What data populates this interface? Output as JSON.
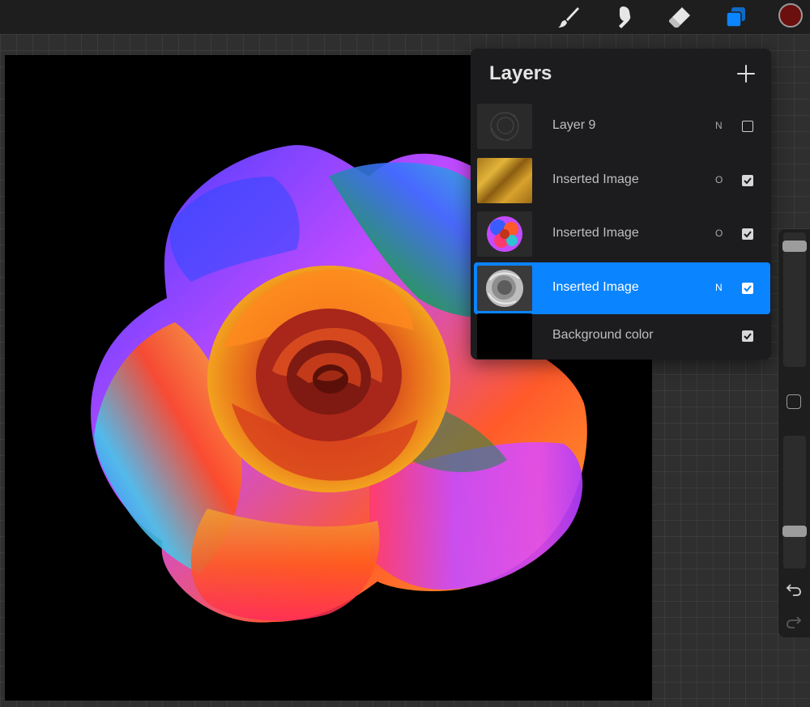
{
  "toolbar": {
    "tools": [
      {
        "name": "brush-icon",
        "active": false
      },
      {
        "name": "smudge-icon",
        "active": false
      },
      {
        "name": "eraser-icon",
        "active": false
      },
      {
        "name": "layers-icon",
        "active": true
      }
    ],
    "current_color": "#6b0f0f"
  },
  "layers_panel": {
    "title": "Layers",
    "layers": [
      {
        "name": "Layer 9",
        "blend": "N",
        "visible": false,
        "selected": false,
        "thumb": "sketch"
      },
      {
        "name": "Inserted Image",
        "blend": "O",
        "visible": true,
        "selected": false,
        "thumb": "gold"
      },
      {
        "name": "Inserted Image",
        "blend": "O",
        "visible": true,
        "selected": false,
        "thumb": "color-rose"
      },
      {
        "name": "Inserted Image",
        "blend": "N",
        "visible": true,
        "selected": true,
        "thumb": "gray-rose"
      },
      {
        "name": "Background color",
        "blend": "",
        "visible": true,
        "selected": false,
        "thumb": "black"
      }
    ]
  },
  "colors": {
    "accent": "#0a84ff",
    "panel_bg": "#1c1c1e",
    "canvas_bg": "#000000"
  },
  "sidebar": {
    "brush_size_level": 0.96,
    "opacity_level": 0.25,
    "undo_icon": "undo-icon",
    "redo_icon": "redo-icon"
  }
}
